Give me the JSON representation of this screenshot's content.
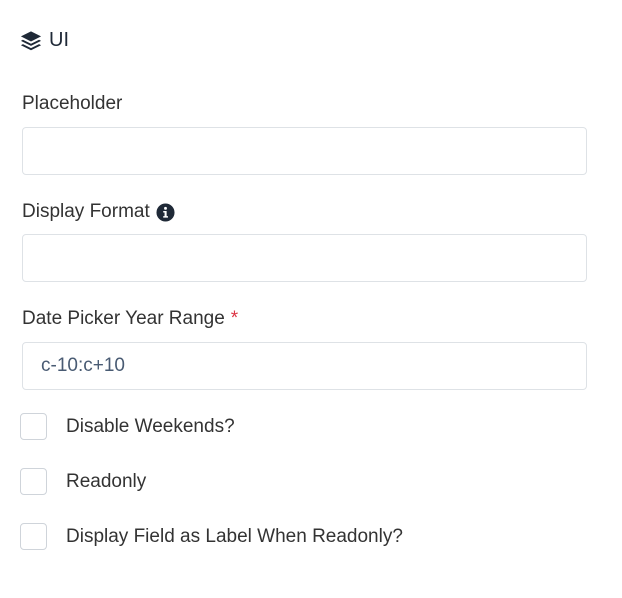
{
  "section": {
    "title": "UI",
    "icon": "layers-icon"
  },
  "fields": {
    "placeholder": {
      "label": "Placeholder",
      "value": ""
    },
    "display_format": {
      "label": "Display Format",
      "value": "",
      "info_icon": "info-circle-icon"
    },
    "year_range": {
      "label": "Date Picker Year Range",
      "required_mark": "*",
      "value": "c-10:c+10"
    }
  },
  "checkboxes": [
    {
      "label": "Disable Weekends?",
      "checked": false
    },
    {
      "label": "Readonly",
      "checked": false
    },
    {
      "label": "Display Field as Label When Readonly?",
      "checked": false
    }
  ],
  "colors": {
    "required": "#dc3545",
    "input_border": "#dee2e6",
    "text": "#333333"
  }
}
